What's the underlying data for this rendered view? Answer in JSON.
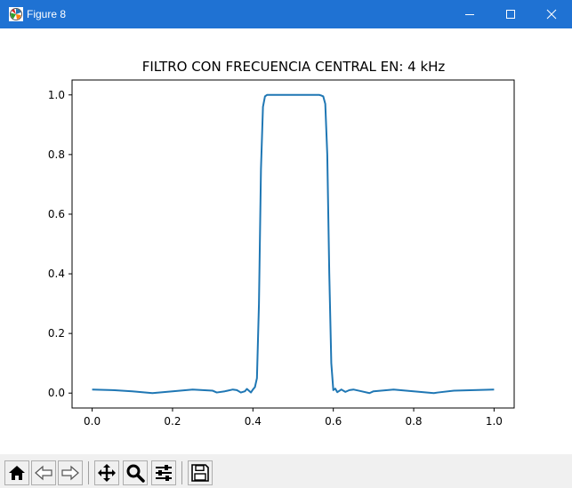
{
  "window": {
    "title": "Figure 8",
    "titlebar_color": "#1f72d3",
    "controls": [
      "minimize-icon",
      "maximize-icon",
      "close-icon"
    ]
  },
  "chart_data": {
    "type": "line",
    "title": "FILTRO CON FRECUENCIA CENTRAL EN:  4 kHz",
    "xlabel": "",
    "ylabel": "",
    "xlim": [
      -0.05,
      1.05
    ],
    "ylim": [
      -0.05,
      1.05
    ],
    "xticks": [
      "0.0",
      "0.2",
      "0.4",
      "0.6",
      "0.8",
      "1.0"
    ],
    "yticks": [
      "0.0",
      "0.2",
      "0.4",
      "0.6",
      "0.8",
      "1.0"
    ],
    "grid": false,
    "legend": "none",
    "series": [
      {
        "color": "#1f77b4",
        "x": [
          0.0,
          0.05,
          0.1,
          0.15,
          0.2,
          0.25,
          0.3,
          0.31,
          0.33,
          0.35,
          0.36,
          0.37,
          0.38,
          0.385,
          0.39,
          0.395,
          0.4,
          0.405,
          0.41,
          0.415,
          0.42,
          0.425,
          0.43,
          0.435,
          0.44,
          0.45,
          0.5,
          0.55,
          0.56,
          0.565,
          0.57,
          0.575,
          0.58,
          0.585,
          0.59,
          0.595,
          0.6,
          0.605,
          0.61,
          0.62,
          0.63,
          0.64,
          0.65,
          0.67,
          0.69,
          0.7,
          0.75,
          0.8,
          0.85,
          0.86,
          0.9,
          0.95,
          1.0
        ],
        "y": [
          0.012,
          0.01,
          0.006,
          0.0,
          0.006,
          0.012,
          0.008,
          0.002,
          0.006,
          0.012,
          0.01,
          0.002,
          0.006,
          0.014,
          0.008,
          0.002,
          0.012,
          0.02,
          0.05,
          0.3,
          0.75,
          0.96,
          0.995,
          1.0,
          1.0,
          1.0,
          1.0,
          1.0,
          1.0,
          1.0,
          0.998,
          0.995,
          0.97,
          0.8,
          0.4,
          0.1,
          0.01,
          0.015,
          0.003,
          0.012,
          0.004,
          0.01,
          0.012,
          0.006,
          0.0,
          0.006,
          0.012,
          0.006,
          0.0,
          0.002,
          0.008,
          0.01,
          0.012
        ]
      }
    ]
  },
  "toolbar": {
    "buttons": [
      {
        "icon": "home-icon"
      },
      {
        "icon": "back-arrow-icon"
      },
      {
        "icon": "forward-arrow-icon"
      },
      {
        "icon": "pan-icon"
      },
      {
        "icon": "zoom-icon"
      },
      {
        "icon": "subplots-config-icon"
      },
      {
        "icon": "save-icon"
      }
    ]
  }
}
